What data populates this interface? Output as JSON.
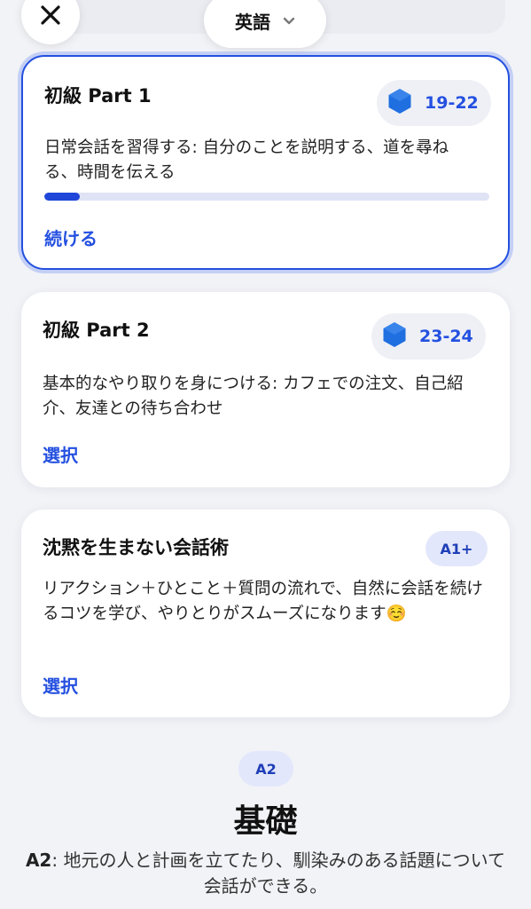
{
  "header": {
    "close_icon": "close-icon",
    "language_label": "英語",
    "dropdown_icon": "chevron-down-icon"
  },
  "courses": [
    {
      "title": "初級 Part 1",
      "units": "19-22",
      "description": "日常会話を習得する: 自分のことを説明する、道を尋ねる、時間を伝える",
      "progress_fraction": 0.08,
      "action": "続ける",
      "selected": true
    },
    {
      "title": "初級 Part 2",
      "units": "23-24",
      "description": "基本的なやり取りを身につける: カフェでの注文、自己紹介、友達との待ち合わせ",
      "action": "選択"
    },
    {
      "title": "沈黙を生まない会話術",
      "level": "A1+",
      "description": "リアクション＋ひとこと＋質問の流れで、自然に会話を続けるコツを学び、やりとりがスムーズになります☺️",
      "action": "選択"
    }
  ],
  "section": {
    "level_badge": "A2",
    "title": "基礎",
    "desc_level": "A2",
    "desc_text": ": 地元の人と計画を立てたり、馴染みのある話題について会話ができる。"
  },
  "colors": {
    "accent": "#2450e0",
    "background": "#f2f3f7",
    "hexagon": "#1f6fe0"
  }
}
